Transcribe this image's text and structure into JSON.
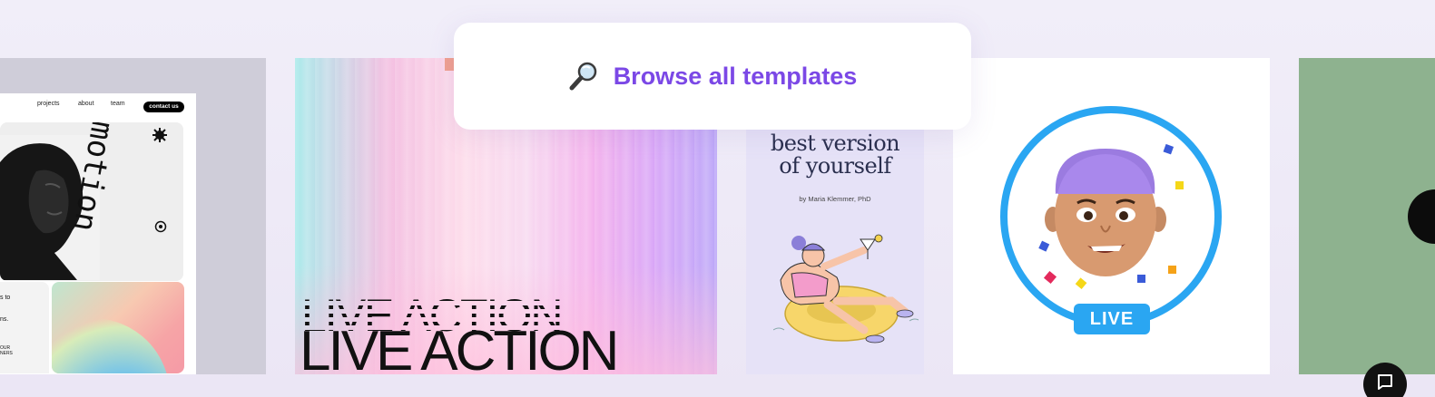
{
  "browse": {
    "label": "Browse all templates",
    "icon": "magnifier-icon",
    "accent": "#7b48e6"
  },
  "cards": {
    "portfolio": {
      "nav": [
        "projects",
        "about",
        "team"
      ],
      "cta": "contact us",
      "side_text_1": "s to",
      "side_text_2": "ns.",
      "side_text_3": "OUR",
      "side_text_4": "NERS",
      "word": "motion"
    },
    "live_action": {
      "text": "LIVE ACTION",
      "ghost_text": "LIVE ACTION"
    },
    "book": {
      "title_line1": "best version",
      "title_line2": "of yourself",
      "author": "by Maria Klemmer, PhD"
    },
    "stream": {
      "badge": "LIVE",
      "ring_color": "#2aa6f2"
    }
  }
}
